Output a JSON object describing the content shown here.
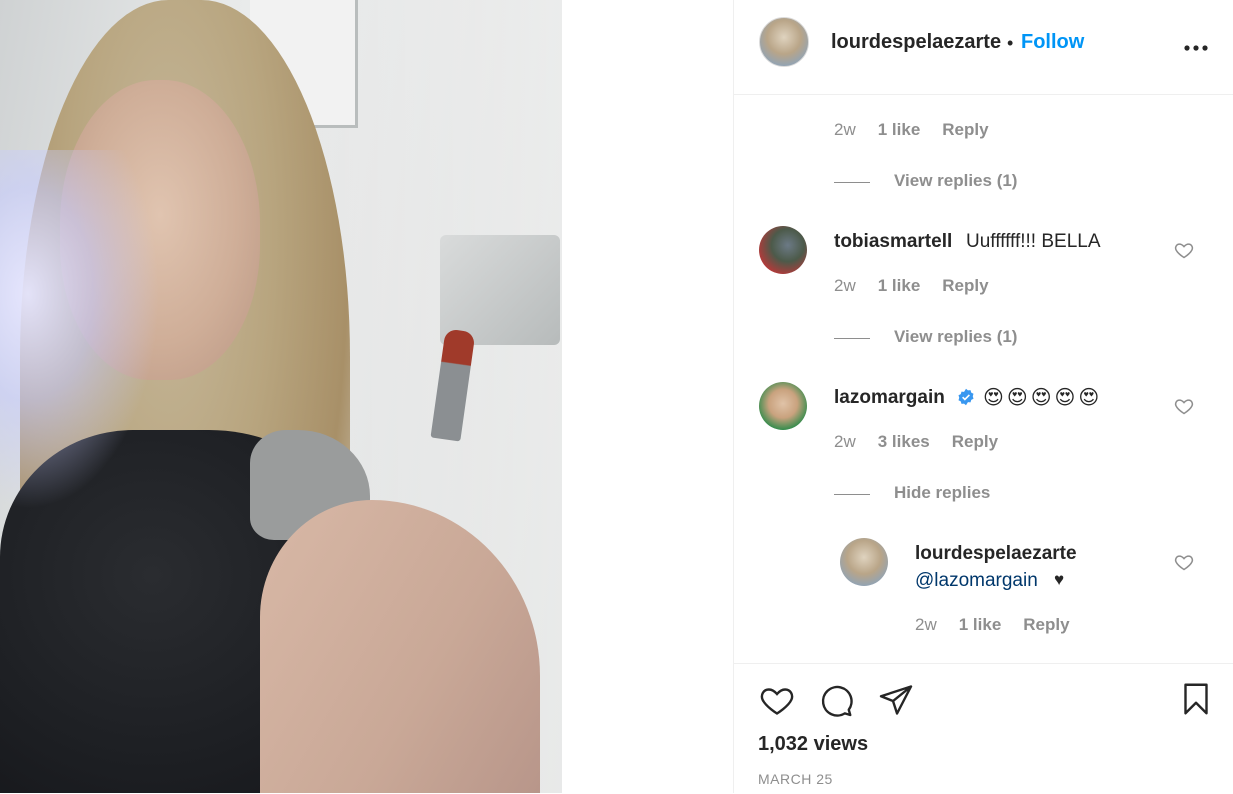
{
  "post": {
    "author": "lourdespelaezarte",
    "separator": "•",
    "follow_label": "Follow",
    "more_label": "•••"
  },
  "comments": [
    {
      "meta": {
        "time": "2w",
        "likes": "1 like",
        "reply": "Reply"
      },
      "view_replies": "View replies (1)"
    },
    {
      "user": "tobiasmartell",
      "text": "Uuffffff!!! BELLA",
      "meta": {
        "time": "2w",
        "likes": "1 like",
        "reply": "Reply"
      },
      "view_replies": "View replies (1)"
    },
    {
      "user": "lazomargain",
      "verified": true,
      "text": "😍😍😍😍😍",
      "meta": {
        "time": "2w",
        "likes": "3 likes",
        "reply": "Reply"
      },
      "hide_replies": "Hide replies",
      "reply_item": {
        "user": "lourdespelaezarte",
        "mention": "@lazomargain",
        "suffix": "♥",
        "meta": {
          "time": "2w",
          "likes": "1 like",
          "reply": "Reply"
        }
      }
    }
  ],
  "footer": {
    "views": "1,032 views",
    "date": "MARCH 25"
  },
  "colors": {
    "accent": "#0095f6",
    "mention": "#00376b",
    "muted": "#8e8e8e",
    "verified": "#3897f0"
  },
  "icons": [
    "more-icon",
    "heart-icon",
    "comment-icon",
    "share-icon",
    "bookmark-icon",
    "verified-badge-icon"
  ]
}
